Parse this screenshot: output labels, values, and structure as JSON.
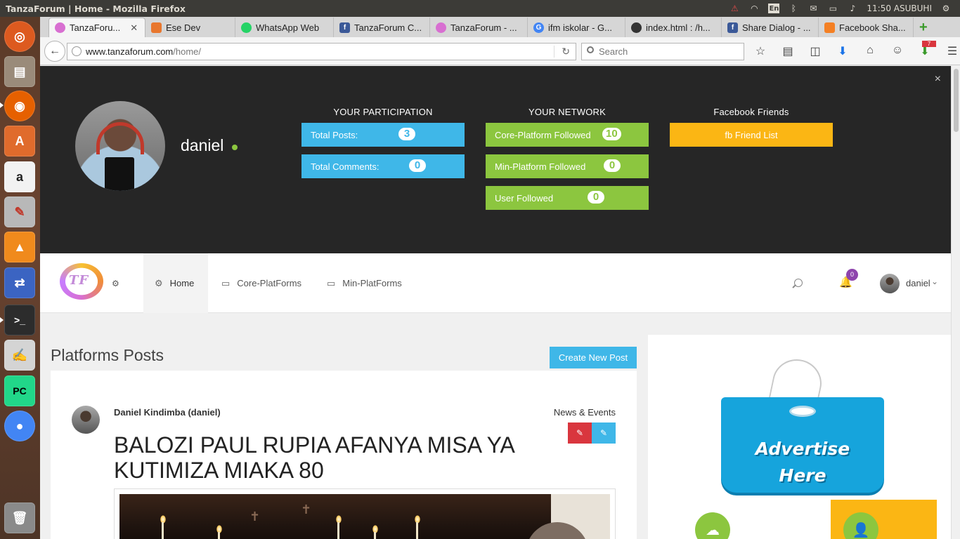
{
  "os": {
    "window_title": "TanzaForum | Home - Mozilla Firefox",
    "language_indicator": "En",
    "clock": "11:50 ASUBUHI",
    "tray_icons": [
      "alert-icon",
      "wifi-icon",
      "keyboard-icon",
      "bluetooth-icon",
      "mail-icon",
      "battery-icon",
      "volume-icon"
    ],
    "launcher_items": [
      {
        "name": "ubuntu-dash",
        "glyph": "◎",
        "color": "#dd5a1f"
      },
      {
        "name": "files",
        "glyph": "▤",
        "color": "#9a8b7a"
      },
      {
        "name": "firefox",
        "glyph": "◉",
        "color": "#e66000"
      },
      {
        "name": "software-center",
        "glyph": "A",
        "color": "#e06b2c"
      },
      {
        "name": "amazon",
        "glyph": "a",
        "color": "#f2f2f2"
      },
      {
        "name": "system-settings",
        "glyph": "✎",
        "color": "#b8b8b8"
      },
      {
        "name": "vlc",
        "glyph": "▲",
        "color": "#f08a1c"
      },
      {
        "name": "remote-desktop",
        "glyph": "⇄",
        "color": "#3b64c2"
      },
      {
        "name": "terminal",
        "glyph": ">_",
        "color": "#2c2c2c"
      },
      {
        "name": "text-editor",
        "glyph": "✍",
        "color": "#d4d4d4"
      },
      {
        "name": "pycharm",
        "glyph": "PC",
        "color": "#21d789"
      },
      {
        "name": "chrome",
        "glyph": "●",
        "color": "#4285f4"
      },
      {
        "name": "trash",
        "glyph": "🗑",
        "color": "#bbbbbb"
      }
    ]
  },
  "browser": {
    "tabs": [
      {
        "label": "TanzaForu...",
        "favicon_color": "#d86fd1",
        "active": true
      },
      {
        "label": "Ese Dev",
        "favicon_color": "#e8772e",
        "active": false
      },
      {
        "label": "WhatsApp Web",
        "favicon_color": "#25d366",
        "active": false
      },
      {
        "label": "TanzaForum C...",
        "favicon_color": "#3b5998",
        "active": false
      },
      {
        "label": "TanzaForum - ...",
        "favicon_color": "#d86fd1",
        "active": false
      },
      {
        "label": "ifm iskolar - G...",
        "favicon_color": "#4285f4",
        "active": false
      },
      {
        "label": "index.html : /h...",
        "favicon_color": "#333333",
        "active": false
      },
      {
        "label": "Share Dialog - ...",
        "favicon_color": "#3b5998",
        "active": false
      },
      {
        "label": "Facebook Sha...",
        "favicon_color": "#f48024",
        "active": false
      }
    ],
    "url_host": "www.tanzaforum.com",
    "url_path": "/home/",
    "search_placeholder": "Search",
    "download_badge": "7"
  },
  "profile_panel": {
    "username": "daniel",
    "participation_title": "YOUR PARTICIPATION",
    "network_title": "YOUR NETWORK",
    "facebook_title": "Facebook Friends",
    "participation": [
      {
        "label": "Total Posts:",
        "count": "3"
      },
      {
        "label": "Total Comments:",
        "count": "0"
      }
    ],
    "network": [
      {
        "label": "Core-Platform Followed",
        "count": "10"
      },
      {
        "label": "Min-Platform Followed",
        "count": "0"
      },
      {
        "label": "User Followed",
        "count": "0"
      }
    ],
    "fb_button": "fb Friend List"
  },
  "site_nav": {
    "logo_text": "TF",
    "items": [
      {
        "label": "Home"
      },
      {
        "label": "Core-PlatForms"
      },
      {
        "label": "Min-PlatForms"
      }
    ],
    "notification_count": "0",
    "username": "daniel"
  },
  "main": {
    "section_title": "Platforms Posts",
    "create_button": "Create New Post",
    "post": {
      "author": "Daniel Kindimba (daniel)",
      "category": "News & Events",
      "headline": "BALOZI PAUL RUPIA AFANYA MISA YA KUTIMIZA MIAKA 80"
    }
  },
  "sidebar": {
    "ad_text_line1": "Advertise",
    "ad_text_line2": "Here"
  },
  "colors": {
    "accent_blue": "#3fb7e8",
    "accent_green": "#8cc63f",
    "accent_orange": "#fbb614",
    "danger_red": "#d9363e",
    "panel_dark": "#262626"
  }
}
